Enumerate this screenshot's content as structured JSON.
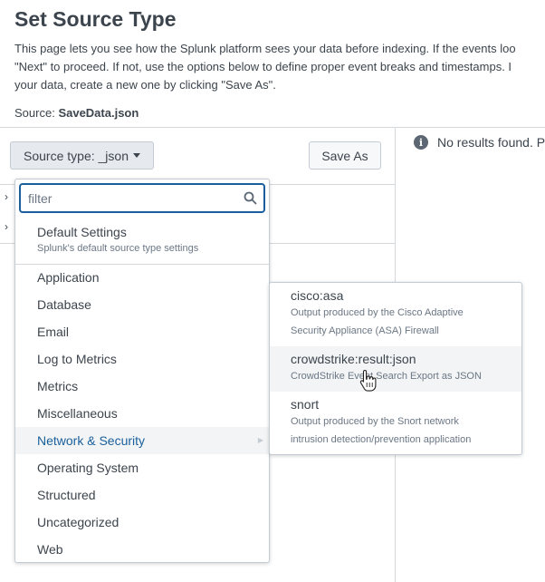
{
  "page": {
    "title": "Set Source Type",
    "description_lines": [
      "This page lets you see how the Splunk platform sees your data before indexing. If the events loo",
      "\"Next\" to proceed. If not, use the options below to define proper event breaks and timestamps. I",
      "your data, create a new one by clicking \"Save As\"."
    ],
    "source_label": "Source:",
    "source_value": "SaveData.json"
  },
  "toolbar": {
    "source_type_label": "Source type: _json",
    "save_as_label": "Save As"
  },
  "results": {
    "message": "No results found. Pl",
    "icon": "info-icon"
  },
  "dropdown": {
    "filter_placeholder": "filter",
    "filter_value": "",
    "default": {
      "label": "Default Settings",
      "description": "Splunk's default source type settings"
    },
    "categories": [
      "Application",
      "Database",
      "Email",
      "Log to Metrics",
      "Metrics",
      "Miscellaneous",
      "Network & Security",
      "Operating System",
      "Structured",
      "Uncategorized",
      "Web"
    ],
    "active_category": "Network & Security"
  },
  "submenu": {
    "items": [
      {
        "name": "cisco:asa",
        "desc1": "Output produced by the Cisco Adaptive",
        "desc2": "Security Appliance (ASA) Firewall"
      },
      {
        "name": "crowdstrike:result:json",
        "desc1": "CrowdStrike Event Search Export as JSON"
      },
      {
        "name": "snort",
        "desc1": "Output produced by the Snort network",
        "desc2": "intrusion detection/prevention application"
      }
    ],
    "hovered": "crowdstrike:result:json"
  },
  "colors": {
    "accent": "#1a5f9c",
    "text": "#3c444d",
    "muted": "#6b7785",
    "border": "#c3cbd4",
    "hover_bg": "#f2f4f5"
  }
}
